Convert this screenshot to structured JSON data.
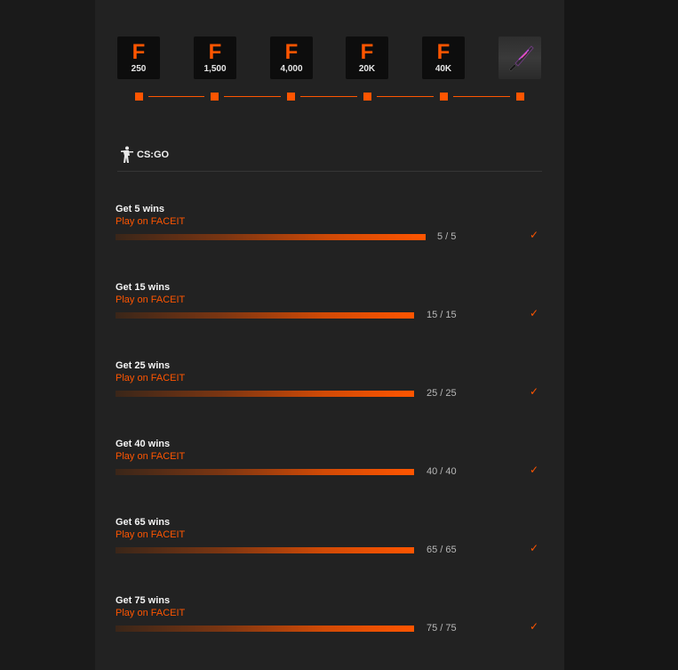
{
  "colors": {
    "accent": "#ff5500",
    "panel": "#222222",
    "background": "#191919"
  },
  "rewards": [
    {
      "icon": "faceit-points-icon",
      "logo": "F",
      "amount": "250"
    },
    {
      "icon": "faceit-points-icon",
      "logo": "F",
      "amount": "1,500"
    },
    {
      "icon": "faceit-points-icon",
      "logo": "F",
      "amount": "4,000"
    },
    {
      "icon": "faceit-points-icon",
      "logo": "F",
      "amount": "20K"
    },
    {
      "icon": "faceit-points-icon",
      "logo": "F",
      "amount": "40K"
    },
    {
      "icon": "knife-skin-icon",
      "logo": "",
      "amount": ""
    }
  ],
  "game": {
    "icon": "cs-go-player-icon",
    "name": "CS:GO"
  },
  "missions": [
    {
      "title": "Get 5 wins",
      "subtitle": "Play on FACEIT",
      "progress": "5 / 5",
      "fraction": 1.0,
      "status_icon": "checkmark-icon",
      "check": "✓"
    },
    {
      "title": "Get 15 wins",
      "subtitle": "Play on FACEIT",
      "progress": "15 / 15",
      "fraction": 1.0,
      "status_icon": "checkmark-icon",
      "check": "✓"
    },
    {
      "title": "Get 25 wins",
      "subtitle": "Play on FACEIT",
      "progress": "25 / 25",
      "fraction": 1.0,
      "status_icon": "checkmark-icon",
      "check": "✓"
    },
    {
      "title": "Get 40 wins",
      "subtitle": "Play on FACEIT",
      "progress": "40 / 40",
      "fraction": 1.0,
      "status_icon": "checkmark-icon",
      "check": "✓"
    },
    {
      "title": "Get 65 wins",
      "subtitle": "Play on FACEIT",
      "progress": "65 / 65",
      "fraction": 1.0,
      "status_icon": "checkmark-icon",
      "check": "✓"
    },
    {
      "title": "Get 75 wins",
      "subtitle": "Play on FACEIT",
      "progress": "75 / 75",
      "fraction": 1.0,
      "status_icon": "checkmark-icon",
      "check": "✓"
    }
  ]
}
